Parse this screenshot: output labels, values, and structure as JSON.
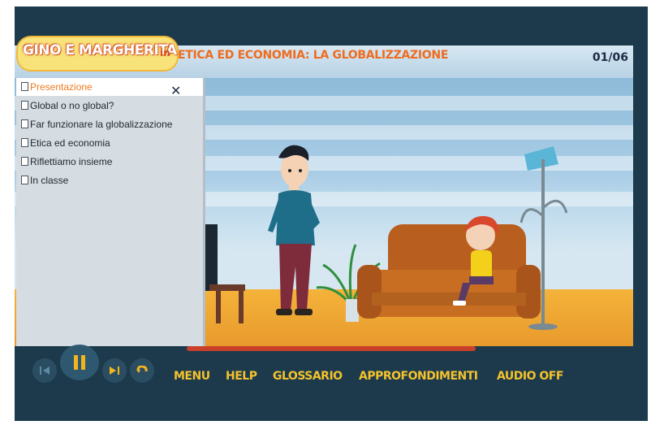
{
  "header": {
    "logo_text": "GINO E MARGHERITA",
    "logo_suffix": "in",
    "title": "ETICA ED ECONOMIA: LA GLOBALIZZAZIONE",
    "page_counter": "01/06"
  },
  "menu": {
    "close_icon": "close-icon",
    "items": [
      {
        "label": "Presentazione",
        "active": true
      },
      {
        "label": "Global o no global?"
      },
      {
        "label": "Far funzionare la globalizzazione"
      },
      {
        "label": "Etica ed economia"
      },
      {
        "label": "Riflettiamo insieme"
      },
      {
        "label": "In classe"
      }
    ]
  },
  "player": {
    "buttons": [
      "skip-back-icon",
      "pause-icon",
      "skip-forward-icon",
      "undo-icon"
    ]
  },
  "nav": {
    "menu": "MENU",
    "help": "HELP",
    "glossary": "GLOSSARIO",
    "more": "APPROFONDIMENTI",
    "audio": "AUDIO OFF"
  },
  "colors": {
    "frame": "#1d3a4c",
    "accent_orange": "#ef7c1f",
    "nav_yellow": "#f4c22c"
  }
}
